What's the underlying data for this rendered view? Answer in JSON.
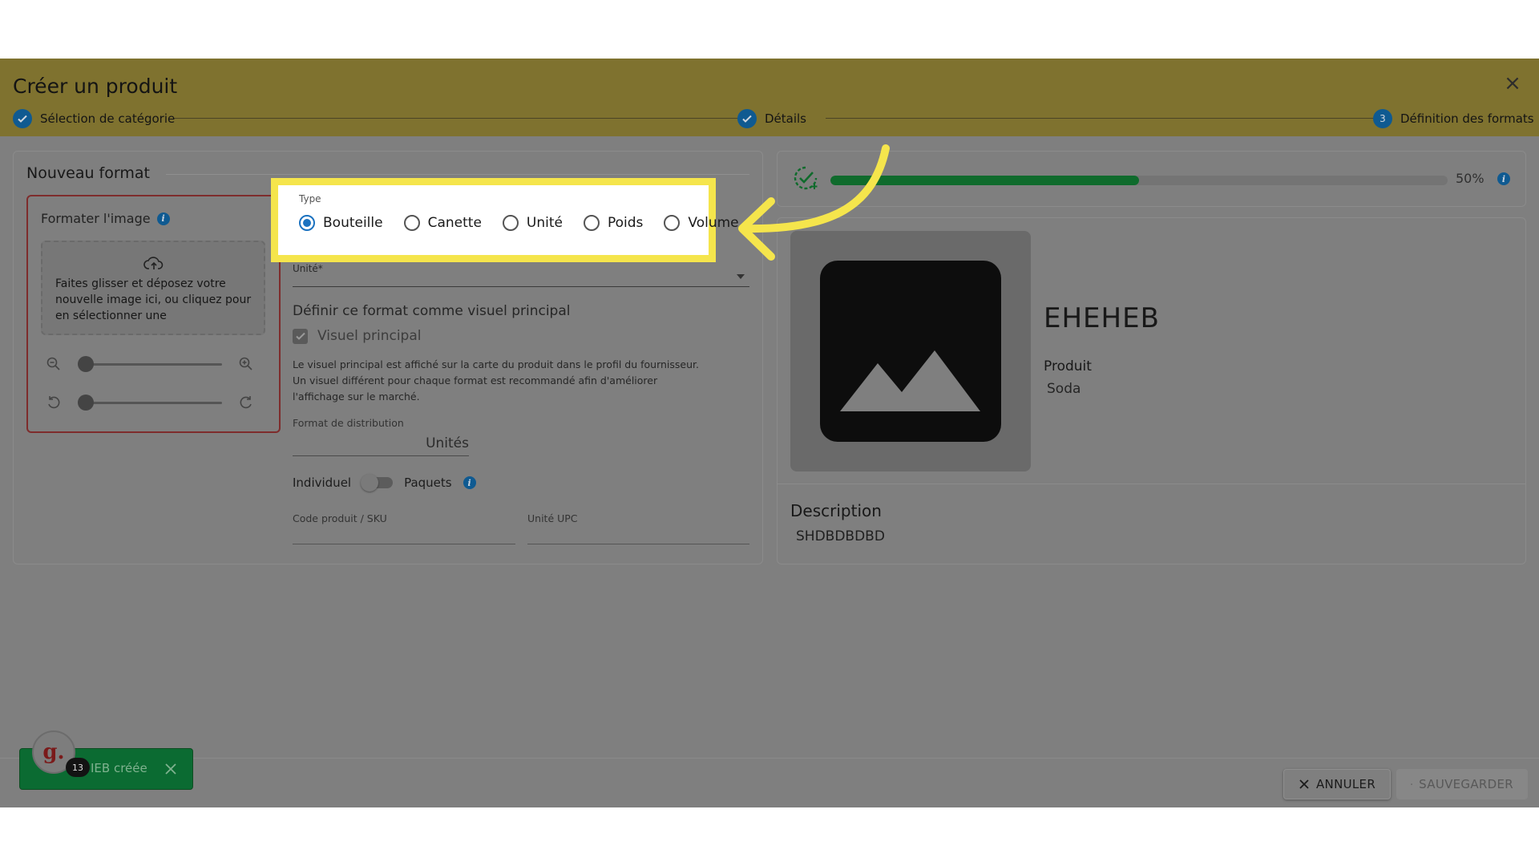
{
  "header": {
    "title": "Créer un produit",
    "steps": [
      {
        "label": "Sélection de catégorie",
        "state": "done"
      },
      {
        "label": "Détails",
        "state": "done"
      },
      {
        "label": "Définition des formats",
        "state": "current",
        "number": "3"
      }
    ]
  },
  "format": {
    "title": "Nouveau format",
    "image_panel": {
      "label": "Formater l'image",
      "drop_text": "Faites glisser et déposez votre nouvelle image ici, ou cliquez pour en sélectionner une",
      "zoom_level": 0,
      "rotation_level": 0
    },
    "type": {
      "label": "Type",
      "options": [
        "Bouteille",
        "Canette",
        "Unité",
        "Poids",
        "Volume"
      ],
      "selected": "Bouteille"
    },
    "unit": {
      "label": "Unité*",
      "value": ""
    },
    "main_visual": {
      "heading": "Définir ce format comme visuel principal",
      "checkbox_label": "Visuel principal",
      "checked": true,
      "help": "Le visuel principal est affiché sur la carte du produit dans le profil du fournisseur. Un visuel différent pour chaque format est recommandé afin d'améliorer l'affichage sur le marché."
    },
    "distribution": {
      "label": "Format de distribution",
      "value": "Unités"
    },
    "pack_toggle": {
      "left": "Individuel",
      "right": "Paquets",
      "on": false
    },
    "sku": {
      "label": "Code produit / SKU",
      "value": ""
    },
    "upc": {
      "label": "Unité UPC",
      "value": ""
    }
  },
  "quality": {
    "percent_label": "50%",
    "percent": 50
  },
  "product": {
    "name": "EHEHEB",
    "category_label": "Produit",
    "category_value": "Soda",
    "description_title": "Description",
    "description_value": "SHDBDBDBD"
  },
  "footer": {
    "cancel_label": "ANNULER",
    "save_label": "SAUVEGARDER"
  },
  "toast": {
    "text": "IEB créée",
    "count": "13",
    "logo": "g."
  },
  "colors": {
    "accent": "#1b72c0",
    "success": "#0f6b2c",
    "highlight": "#f5e54c",
    "header": "#7f722f"
  }
}
